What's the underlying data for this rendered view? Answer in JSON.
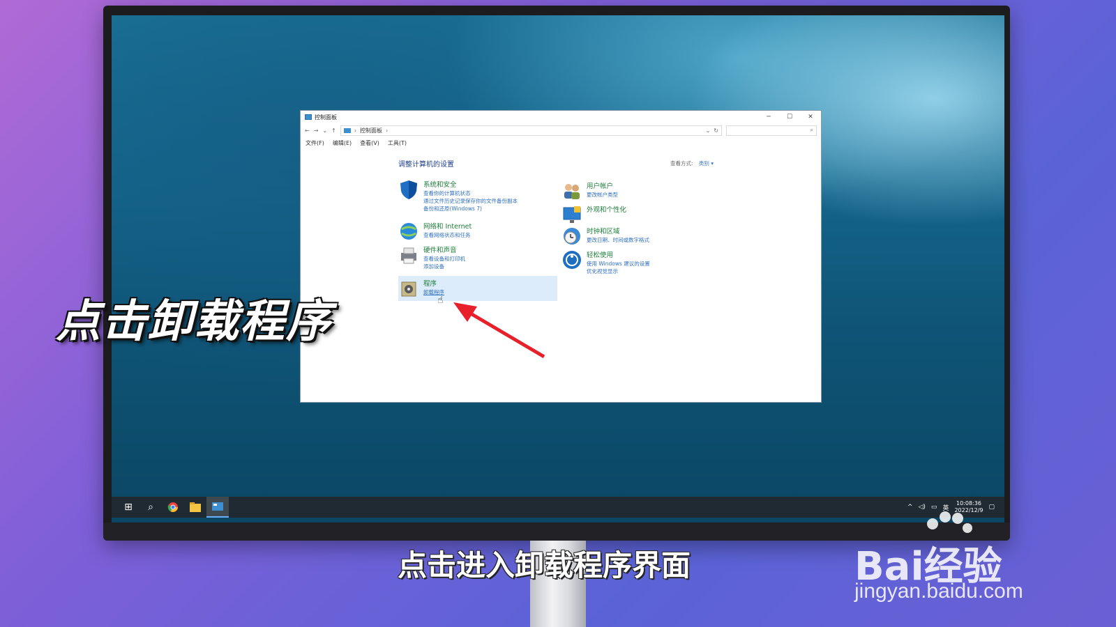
{
  "window": {
    "title": "控制面板",
    "address_crumb": "控制面板",
    "menus": [
      "文件(F)",
      "编辑(E)",
      "查看(V)",
      "工具(T)"
    ],
    "heading": "调整计算机的设置",
    "view_by_label": "查看方式:",
    "view_by_value": "类别 ▾",
    "left_categories": [
      {
        "title": "系统和安全",
        "links": [
          "查看你的计算机状态",
          "通过文件历史记录保存你的文件备份副本",
          "备份和还原(Windows 7)"
        ]
      },
      {
        "title": "网络和 Internet",
        "links": [
          "查看网络状态和任务"
        ]
      },
      {
        "title": "硬件和声音",
        "links": [
          "查看设备和打印机",
          "添加设备"
        ]
      },
      {
        "title": "程序",
        "links": [
          "卸载程序"
        ]
      }
    ],
    "right_categories": [
      {
        "title": "用户帐户",
        "links": [
          "更改帐户类型"
        ]
      },
      {
        "title": "外观和个性化",
        "links": []
      },
      {
        "title": "时钟和区域",
        "links": [
          "更改日期、时间或数字格式"
        ]
      },
      {
        "title": "轻松使用",
        "links": [
          "使用 Windows 建议的设置",
          "优化视觉显示"
        ]
      }
    ]
  },
  "taskbar": {
    "ime": "英",
    "time": "10:08:36",
    "date": "2022/12/9"
  },
  "overlay": {
    "instruction": "点击卸载程序",
    "subtitle": "点击进入卸载程序界面"
  },
  "watermark": {
    "brand": "Bai经验",
    "url": "jingyan.baidu.com"
  },
  "colors": {
    "accent": "#2f70c2",
    "category_title": "#1d7d3a",
    "highlight": "#dcecfb",
    "arrow": "#e8202a"
  }
}
